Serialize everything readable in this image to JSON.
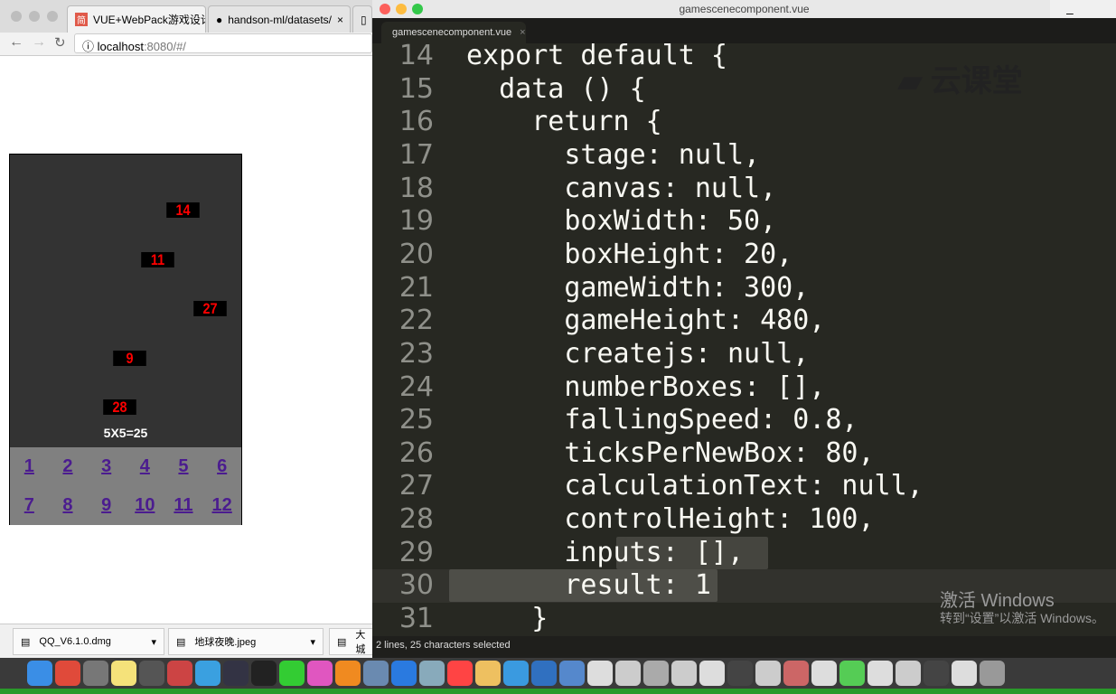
{
  "browser": {
    "tabs": [
      {
        "label": "VUE+WebPack游戏设计",
        "icon": "jianshu-icon"
      },
      {
        "label": "handson-ml/datasets/",
        "icon": "github-icon"
      }
    ],
    "url_host": "localhost",
    "url_rest": ":8080/#/",
    "downloads": [
      {
        "name": "QQ_V6.1.0.dmg"
      },
      {
        "name": "地球夜晚.jpeg"
      },
      {
        "name": "大城"
      }
    ]
  },
  "game": {
    "boxes": [
      {
        "value": "14"
      },
      {
        "value": "11"
      },
      {
        "value": "27"
      },
      {
        "value": "9"
      },
      {
        "value": "28"
      }
    ],
    "calculation": "5X5=25",
    "buttons": [
      "1",
      "2",
      "3",
      "4",
      "5",
      "6",
      "7",
      "8",
      "9",
      "10",
      "11",
      "12"
    ],
    "colors": {
      "background": "#333333",
      "box": "#000000",
      "number": "#ff0000",
      "controls": "#808080",
      "link": "#4b1c8f"
    }
  },
  "editor": {
    "window_title": "gamescenecomponent.vue",
    "tab_label": "gamescenecomponent.vue",
    "lines": [
      {
        "n": "14",
        "t": "export default {"
      },
      {
        "n": "15",
        "t": "  data () {"
      },
      {
        "n": "16",
        "t": "    return {"
      },
      {
        "n": "17",
        "t": "      stage: null,"
      },
      {
        "n": "18",
        "t": "      canvas: null,"
      },
      {
        "n": "19",
        "t": "      boxWidth: 50,"
      },
      {
        "n": "20",
        "t": "      boxHeight: 20,"
      },
      {
        "n": "21",
        "t": "      gameWidth: 300,"
      },
      {
        "n": "22",
        "t": "      gameHeight: 480,"
      },
      {
        "n": "23",
        "t": "      createjs: null,"
      },
      {
        "n": "24",
        "t": "      numberBoxes: [],"
      },
      {
        "n": "25",
        "t": "      fallingSpeed: 0.8,"
      },
      {
        "n": "26",
        "t": "      ticksPerNewBox: 80,"
      },
      {
        "n": "27",
        "t": "      calculationText: null,"
      },
      {
        "n": "28",
        "t": "      controlHeight: 100,"
      },
      {
        "n": "29",
        "t": "      inputs: [],"
      },
      {
        "n": "30",
        "t": "      result: 1"
      },
      {
        "n": "31",
        "t": "    }"
      }
    ],
    "status": "2 lines, 25 characters selected",
    "watermark": "云课堂",
    "activate_title": "激活 Windows",
    "activate_sub": "转到“设置”以激活 Windows。"
  }
}
